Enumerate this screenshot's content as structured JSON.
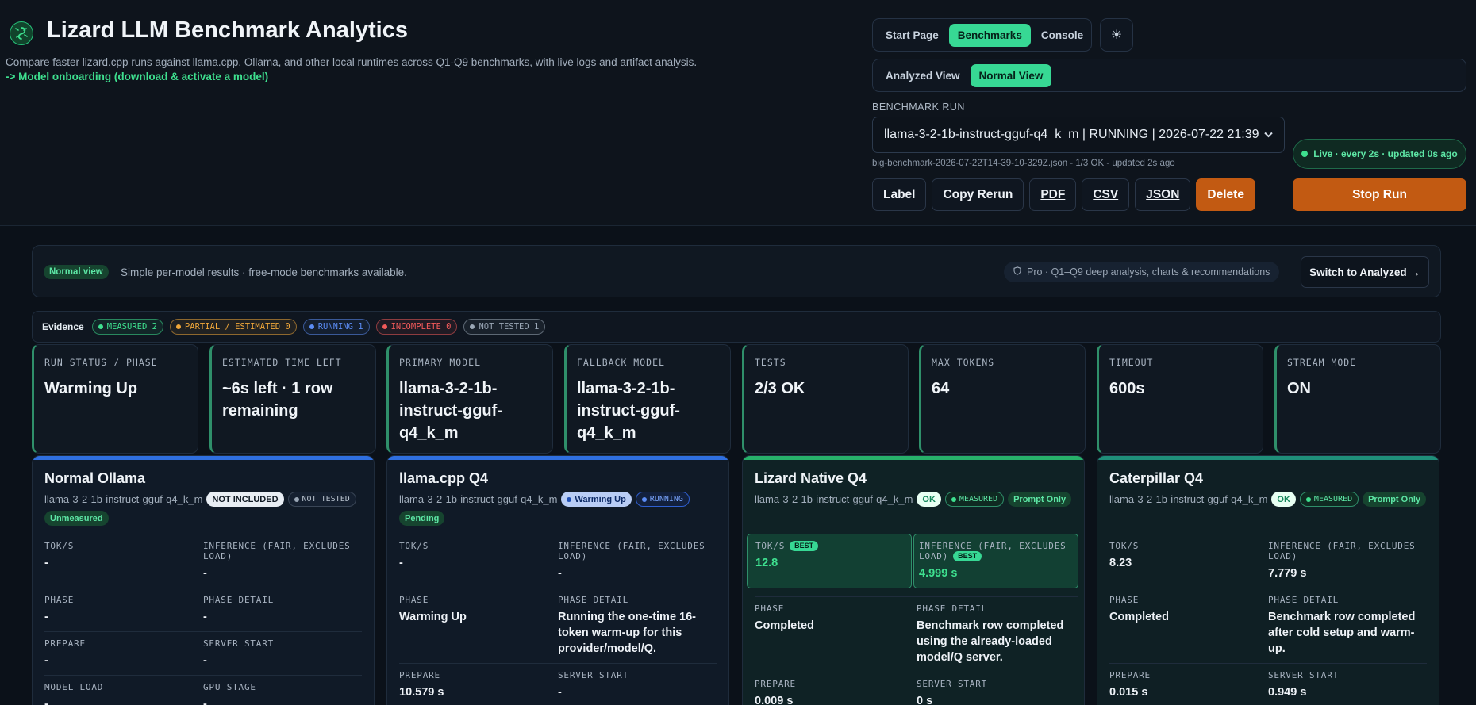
{
  "header": {
    "title": "Lizard LLM Benchmark Analytics",
    "subtitle": "Compare faster lizard.cpp runs against llama.cpp, Ollama, and other local runtimes across Q1-Q9 benchmarks, with live logs and artifact analysis.",
    "onboarding_link": "-> Model onboarding (download & activate a model)",
    "nav": [
      "Start Page",
      "Benchmarks",
      "Console"
    ],
    "nav_active": "Benchmarks",
    "theme_icon": "sun-icon",
    "views": [
      "Analyzed View",
      "Normal View"
    ],
    "view_active": "Normal View",
    "run_label": "BENCHMARK RUN",
    "run_selected": "llama-3-2-1b-instruct-gguf-q4_k_m | RUNNING | 2026-07-22 21:39",
    "run_meta": "big-benchmark-2026-07-22T14-39-10-329Z.json - 1/3 OK - updated 2s ago",
    "live": "Live · every 2s · updated 0s ago",
    "actions": {
      "label": "Label",
      "copy": "Copy Rerun",
      "pdf": "PDF",
      "csv": "CSV",
      "json": "JSON",
      "delete": "Delete"
    },
    "stop": "Stop Run"
  },
  "mode": {
    "tag": "Normal view",
    "text": "Simple per-model results · free-mode benchmarks available.",
    "pro": "Pro · Q1–Q9 deep analysis, charts & recommendations",
    "switch": "Switch to Analyzed →"
  },
  "evidence": {
    "label": "Evidence",
    "items": [
      {
        "text": "MEASURED 2",
        "color": "#3ee08f"
      },
      {
        "text": "PARTIAL / ESTIMATED 0",
        "color": "#f0a73a"
      },
      {
        "text": "RUNNING 1",
        "color": "#5b8cf5"
      },
      {
        "text": "INCOMPLETE 0",
        "color": "#f05a5a"
      },
      {
        "text": "NOT TESTED 1",
        "color": "#9aa6b5"
      }
    ]
  },
  "stats": [
    {
      "label": "RUN STATUS / PHASE",
      "value": "Warming Up"
    },
    {
      "label": "ESTIMATED TIME LEFT",
      "value": "~6s left · 1 row remaining"
    },
    {
      "label": "PRIMARY MODEL",
      "value": "llama-3-2-1b-instruct-gguf-q4_k_m"
    },
    {
      "label": "FALLBACK MODEL",
      "value": "llama-3-2-1b-instruct-gguf-q4_k_m"
    },
    {
      "label": "TESTS",
      "value": "2/3 OK"
    },
    {
      "label": "MAX TOKENS",
      "value": "64"
    },
    {
      "label": "TIMEOUT",
      "value": "600s"
    },
    {
      "label": "STREAM MODE",
      "value": "ON"
    }
  ],
  "cards": [
    {
      "title": "Normal Ollama",
      "model": "llama-3-2-1b-instruct-gguf-q4_k_m",
      "badges": [
        "NOT INCLUDED",
        "NOT TESTED",
        "Unmeasured"
      ],
      "metrics": [
        [
          "TOK/S",
          "-",
          "INFERENCE (FAIR, EXCLUDES LOAD)",
          "-"
        ],
        [
          "PHASE",
          "-",
          "PHASE DETAIL",
          "-"
        ],
        [
          "PREPARE",
          "-",
          "SERVER START",
          "-"
        ],
        [
          "MODEL LOAD",
          "-",
          "GPU STAGE",
          "-"
        ]
      ]
    },
    {
      "title": "llama.cpp Q4",
      "model": "llama-3-2-1b-instruct-gguf-q4_k_m",
      "badges": [
        "Warming Up",
        "RUNNING",
        "Pending"
      ],
      "metrics": [
        [
          "TOK/S",
          "-",
          "INFERENCE (FAIR, EXCLUDES LOAD)",
          "-"
        ],
        [
          "PHASE",
          "Warming Up",
          "PHASE DETAIL",
          "Running the one-time 16-token warm-up for this provider/model/Q."
        ],
        [
          "PREPARE",
          "10.579 s",
          "SERVER START",
          "-"
        ]
      ]
    },
    {
      "title": "Lizard Native Q4",
      "model": "llama-3-2-1b-instruct-gguf-q4_k_m",
      "badges": [
        "OK",
        "MEASURED",
        "Prompt Only"
      ],
      "best_tag": "BEST",
      "metrics": [
        [
          "TOK/S",
          "12.8",
          "INFERENCE (FAIR, EXCLUDES LOAD)",
          "4.999 s"
        ],
        [
          "PHASE",
          "Completed",
          "PHASE DETAIL",
          "Benchmark row completed using the already-loaded model/Q server."
        ],
        [
          "PREPARE",
          "0.009 s",
          "SERVER START",
          "0 s"
        ]
      ]
    },
    {
      "title": "Caterpillar Q4",
      "model": "llama-3-2-1b-instruct-gguf-q4_k_m",
      "badges": [
        "OK",
        "MEASURED",
        "Prompt Only"
      ],
      "metrics": [
        [
          "TOK/S",
          "8.23",
          "INFERENCE (FAIR, EXCLUDES LOAD)",
          "7.779 s"
        ],
        [
          "PHASE",
          "Completed",
          "PHASE DETAIL",
          "Benchmark row completed after cold setup and warm-up."
        ],
        [
          "PREPARE",
          "0.015 s",
          "SERVER START",
          "0.949 s"
        ]
      ]
    }
  ],
  "colors": {
    "accent": "#37d894",
    "danger": "#c25a12",
    "running": "#2f6fe0"
  }
}
